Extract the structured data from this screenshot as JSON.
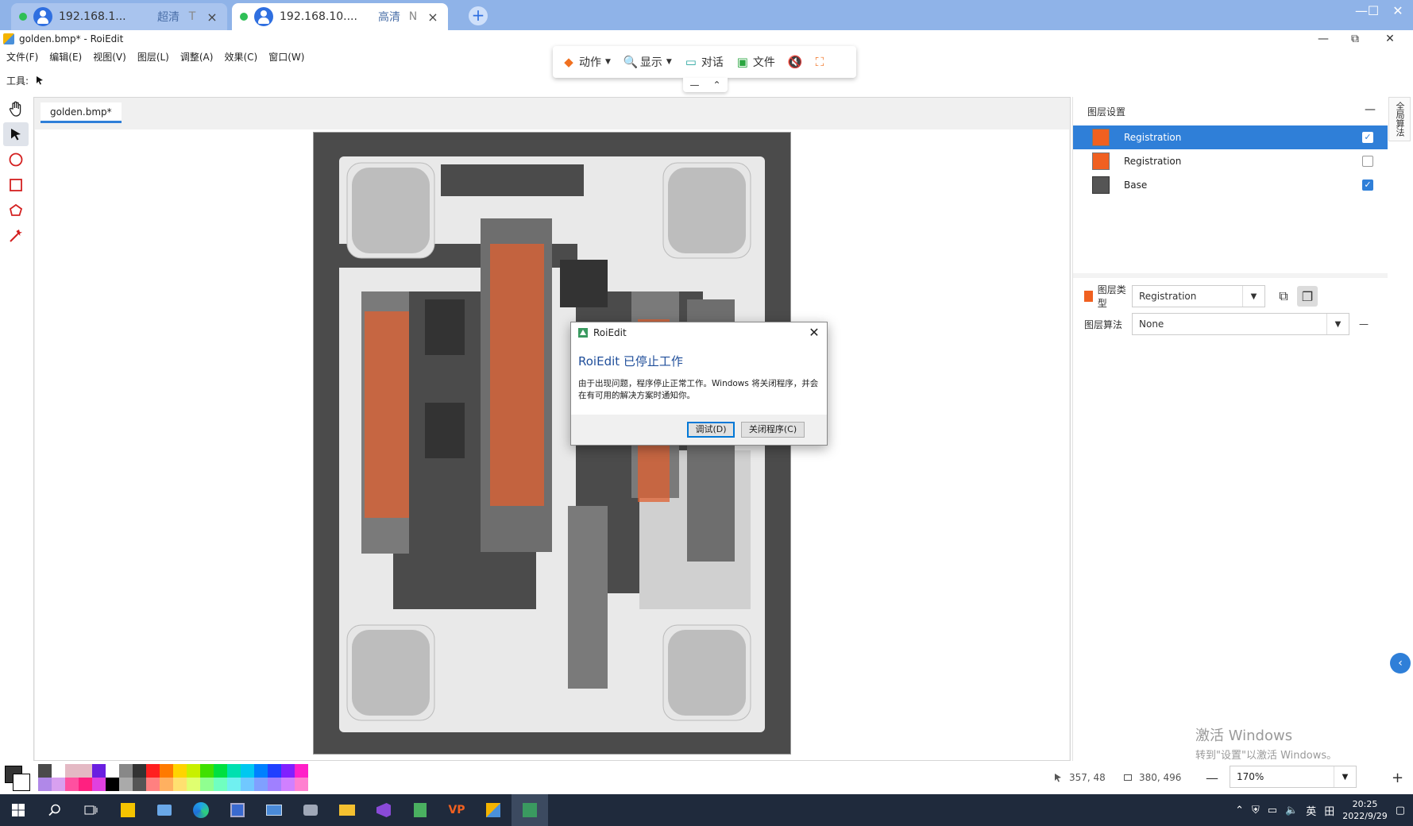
{
  "remote_tabs": [
    {
      "ip": "192.168.1...",
      "quality": "超清",
      "letter": "T",
      "close": "×"
    },
    {
      "ip": "192.168.10....",
      "quality": "高清",
      "letter": "N",
      "close": "×"
    }
  ],
  "new_tab": "+",
  "window_controls": {
    "minimize": "—",
    "maximize": "☐",
    "close": "✕"
  },
  "app": {
    "title": "golden.bmp* - RoiEdit",
    "controls": {
      "minimize": "—",
      "restore": "⧉",
      "close": "✕"
    }
  },
  "menu": [
    "文件(F)",
    "编辑(E)",
    "视图(V)",
    "图层(L)",
    "调整(A)",
    "效果(C)",
    "窗口(W)"
  ],
  "toolbar": {
    "label": "工具:"
  },
  "remote_bar": {
    "items": [
      {
        "label": "动作",
        "icon": "layers-icon",
        "glyph": "◆",
        "dropdown": true
      },
      {
        "label": "显示",
        "icon": "search-icon",
        "glyph": "🔍",
        "dropdown": true
      },
      {
        "label": "对话",
        "icon": "chat-icon",
        "glyph": "▭",
        "dropdown": false
      },
      {
        "label": "文件",
        "icon": "file-icon",
        "glyph": "▣",
        "dropdown": false
      }
    ],
    "mute_glyph": "🔇",
    "fullscreen_glyph": "⛶",
    "sub": {
      "minimize": "—",
      "collapse": "⌃"
    }
  },
  "document_tab": "golden.bmp*",
  "layers_panel": {
    "header": "图层设置",
    "collapse": "—",
    "layers": [
      {
        "name": "Registration",
        "type": "roi",
        "checked": true,
        "selected": true
      },
      {
        "name": "Registration",
        "type": "roi",
        "checked": false,
        "selected": false
      },
      {
        "name": "Base",
        "type": "base",
        "checked": true,
        "selected": false
      }
    ],
    "layer_type_label": "图层类型",
    "layer_type_value": "Registration",
    "layer_algo_label": "图层算法",
    "layer_algo_value": "None",
    "algo_minus": "—"
  },
  "side_tab": "全局算法",
  "watermark": {
    "line1": "激活 Windows",
    "line2": "转到\"设置\"以激活 Windows。"
  },
  "status": {
    "cursor_pos": "357, 48",
    "selection_size": "380, 496",
    "zoom": "170%",
    "zoom_out": "—",
    "zoom_in": "+"
  },
  "dialog": {
    "title": "RoiEdit",
    "heading": "RoiEdit 已停止工作",
    "body": "由于出现问题，程序停止正常工作。Windows 将关闭程序，并会在有可用的解决方案时通知你。",
    "debug_button": "调试(D)",
    "close_program_button": "关闭程序(C)",
    "close": "✕"
  },
  "palette_colors": {
    "row1": [
      "#4a4a4a",
      "#ffffff",
      "#e4b9c4",
      "#e4b9c4",
      "#6a1fe0",
      "#ffffff",
      "#888888",
      "#333333",
      "#ff2020",
      "#ff7a00",
      "#ffd400",
      "#c8f000",
      "#40e000",
      "#00e040",
      "#00e0b0",
      "#00c8f0",
      "#0080ff",
      "#2040ff",
      "#8020ff",
      "#ff20c8"
    ],
    "row2": [
      "#b088e8",
      "#d8a0f0",
      "#ff50a0",
      "#ff2080",
      "#e040e0",
      "#000000",
      "#aaaaaa",
      "#555555",
      "#ff8080",
      "#ffb060",
      "#ffe070",
      "#e0ff70",
      "#90ff90",
      "#70ffc0",
      "#70f0f0",
      "#70c8ff",
      "#80a0ff",
      "#a080ff",
      "#d080ff",
      "#ff80d0"
    ]
  },
  "taskbar": {
    "icons": [
      "windows-start-icon",
      "search-icon",
      "task-view-icon",
      "sticky-notes-icon",
      "app-icon",
      "edge-icon",
      "remote-app-icon",
      "monitor-icon",
      "camera-icon",
      "file-explorer-icon",
      "visual-studio-icon",
      "notepad-icon",
      "vp-icon",
      "package-icon",
      "roiedit-icon"
    ],
    "tray": {
      "ime": "英",
      "grid": "田",
      "time": "20:25",
      "date": "2022/9/29"
    }
  }
}
